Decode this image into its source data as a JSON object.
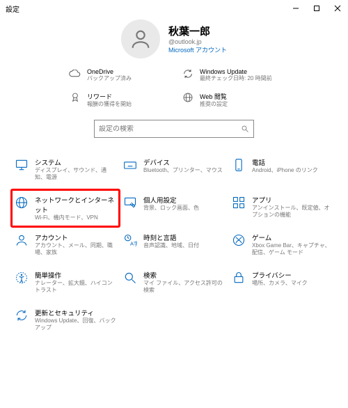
{
  "window": {
    "title": "設定"
  },
  "profile": {
    "name": "秋葉一郎",
    "email": "@outlook.jp",
    "link": "Microsoft アカウント"
  },
  "info": [
    {
      "title": "OneDrive",
      "sub": "バックアップ済み"
    },
    {
      "title": "Windows Update",
      "sub": "最終チェック日時: 20 時間前"
    },
    {
      "title": "リワード",
      "sub": "報酬の獲得を開始"
    },
    {
      "title": "Web 閲覧",
      "sub": "推奨の設定"
    }
  ],
  "search": {
    "placeholder": "設定の検索"
  },
  "cats": [
    {
      "title": "システム",
      "sub": "ディスプレイ、サウンド、通知、電源"
    },
    {
      "title": "デバイス",
      "sub": "Bluetooth、プリンター、マウス"
    },
    {
      "title": "電話",
      "sub": "Android、iPhone のリンク"
    },
    {
      "title": "ネットワークとインターネット",
      "sub": "Wi-Fi、機内モード、VPN"
    },
    {
      "title": "個人用設定",
      "sub": "背景、ロック画面、色"
    },
    {
      "title": "アプリ",
      "sub": "アンインストール、既定値、オプションの機能"
    },
    {
      "title": "アカウント",
      "sub": "アカウント、メール、同期、職場、家族"
    },
    {
      "title": "時刻と言語",
      "sub": "音声認識、地域、日付"
    },
    {
      "title": "ゲーム",
      "sub": "Xbox Game Bar、キャプチャ、配信、ゲーム モード"
    },
    {
      "title": "簡単操作",
      "sub": "ナレーター、拡大鏡、ハイコントラスト"
    },
    {
      "title": "検索",
      "sub": "マイ ファイル、アクセス許可の検索"
    },
    {
      "title": "プライバシー",
      "sub": "場所、カメラ、マイク"
    },
    {
      "title": "更新とセキュリティ",
      "sub": "Windows Update、回復、バックアップ"
    }
  ]
}
